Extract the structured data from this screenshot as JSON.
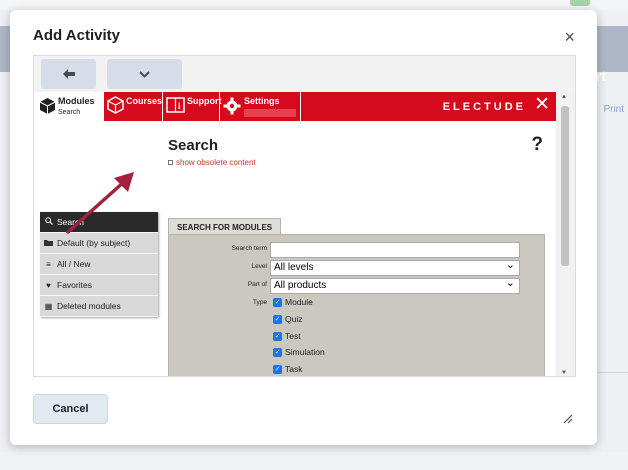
{
  "background": {
    "right_text": "rt",
    "print_link": "Print"
  },
  "dialog": {
    "title": "Add Activity",
    "close_symbol": "×",
    "cancel_label": "Cancel",
    "resize_symbol": "⟋"
  },
  "nav": {
    "modules_label": "Modules",
    "modules_sub": "Search",
    "courses_label": "Courses",
    "support_label": "Support",
    "settings_label": "Settings",
    "brand": "ELECTUDE",
    "close_symbol": "✕"
  },
  "content": {
    "title": "Search",
    "obsolete_link": "show obsolete content",
    "help_symbol": "?"
  },
  "menu": {
    "items": [
      {
        "label": "Search",
        "icon": "search-icon",
        "glyph": "🔍"
      },
      {
        "label": "Default (by subject)",
        "icon": "folder-icon",
        "glyph": "■"
      },
      {
        "label": "All / New",
        "icon": "list-icon",
        "glyph": "≡"
      },
      {
        "label": "Favorites",
        "icon": "heart-icon",
        "glyph": "♥"
      },
      {
        "label": "Deleted modules",
        "icon": "trash-icon",
        "glyph": "▦"
      }
    ]
  },
  "search_form": {
    "tab_label": "SEARCH FOR MODULES",
    "search_term_label": "Search term",
    "search_term_value": "",
    "level_label": "Level",
    "level_value": "All levels",
    "part_of_label": "Part of",
    "part_of_value": "All products",
    "type_label": "Type",
    "types": [
      "Module",
      "Quiz",
      "Test",
      "Simulation",
      "Task"
    ]
  },
  "colors": {
    "accent_red": "#d50a1d",
    "checkbox_blue": "#1a73e8"
  }
}
